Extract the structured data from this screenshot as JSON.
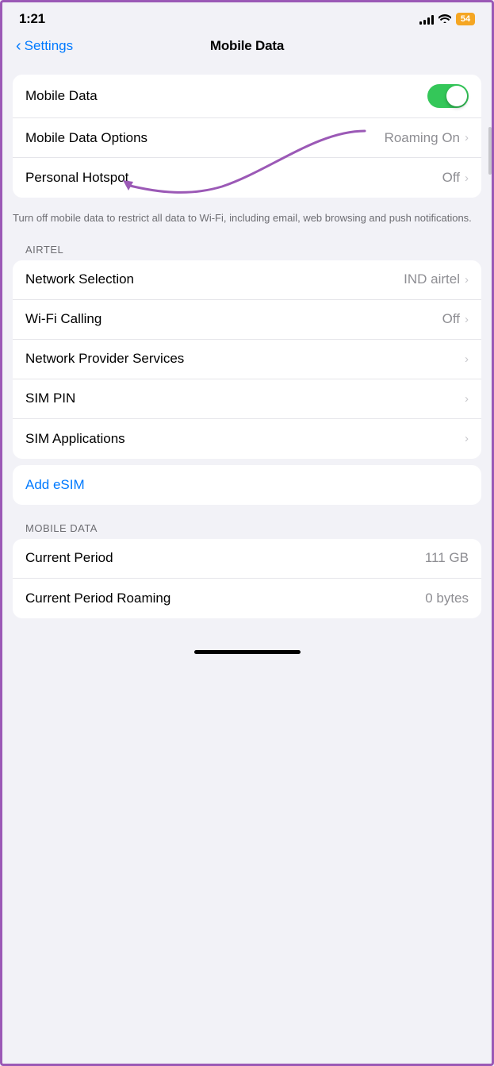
{
  "statusBar": {
    "time": "1:21",
    "battery": "54"
  },
  "navBar": {
    "backLabel": "Settings",
    "title": "Mobile Data"
  },
  "mainSection": {
    "rows": [
      {
        "label": "Mobile Data",
        "type": "toggle",
        "toggleOn": true
      },
      {
        "label": "Mobile Data Options",
        "type": "value-chevron",
        "value": "Roaming On"
      },
      {
        "label": "Personal Hotspot",
        "type": "value-chevron",
        "value": "Off"
      }
    ],
    "note": "Turn off mobile data to restrict all data to Wi-Fi, including email, web browsing and push notifications."
  },
  "airtelSection": {
    "sectionLabel": "AIRTEL",
    "rows": [
      {
        "label": "Network Selection",
        "type": "value-chevron",
        "value": "IND airtel"
      },
      {
        "label": "Wi-Fi Calling",
        "type": "value-chevron",
        "value": "Off"
      },
      {
        "label": "Network Provider Services",
        "type": "chevron",
        "value": ""
      },
      {
        "label": "SIM PIN",
        "type": "chevron",
        "value": ""
      },
      {
        "label": "SIM Applications",
        "type": "chevron",
        "value": ""
      }
    ]
  },
  "esimSection": {
    "label": "Add eSIM"
  },
  "mobileDataSection": {
    "sectionLabel": "MOBILE DATA",
    "rows": [
      {
        "label": "Current Period",
        "type": "value",
        "value": "111 GB"
      },
      {
        "label": "Current Period Roaming",
        "type": "value",
        "value": "0 bytes"
      }
    ]
  }
}
